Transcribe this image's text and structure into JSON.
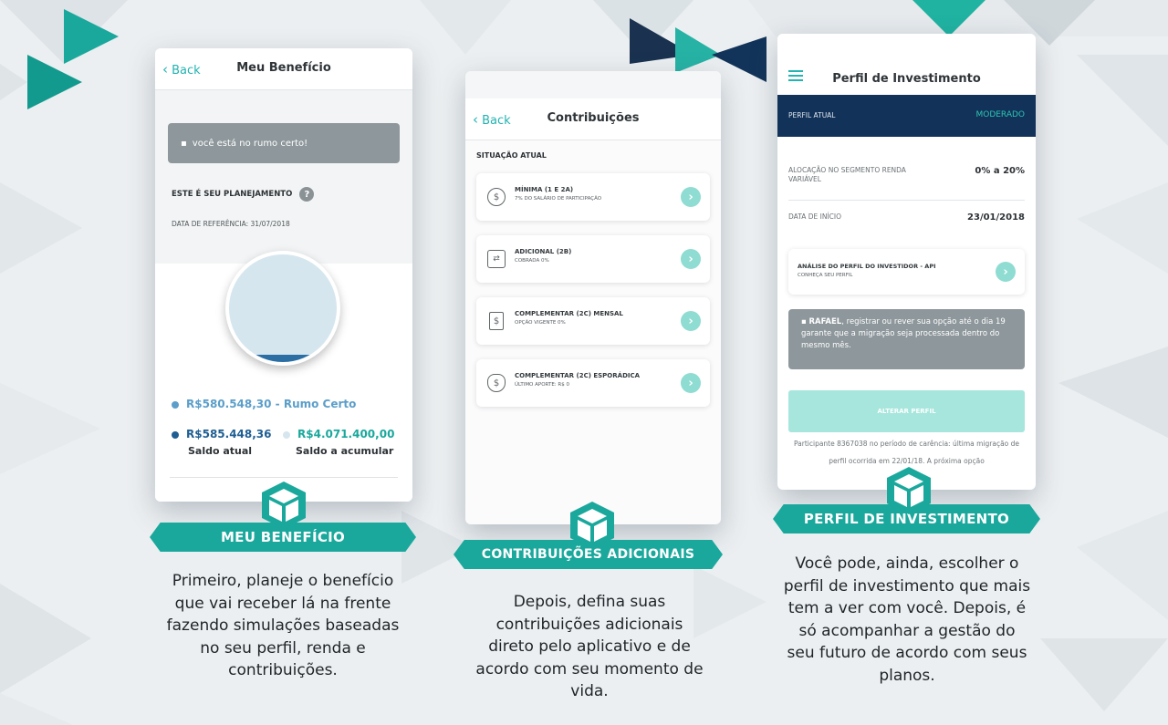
{
  "panels": {
    "beneficio": {
      "back": "Back",
      "title": "Meu Benefício",
      "banner": "você está no rumo certo!",
      "planning_heading": "ESTE É SEU PLANEJAMENTO",
      "help_badge": "?",
      "ref_date": "DATA DE REFERÊNCIA: 31/07/2018",
      "rumo_certo": "R$580.548,30 - Rumo Certo",
      "saldo_atual_value": "R$585.448,36",
      "saldo_atual_label": "Saldo atual",
      "saldo_acumular_value": "R$4.071.400,00",
      "saldo_acumular_label": "Saldo a acumular",
      "fill_fraction": 0.07
    },
    "contribuicoes": {
      "back": "Back",
      "title": "Contribuições",
      "section": "SITUAÇÃO ATUAL",
      "items": [
        {
          "title": "MÍNIMA (1 E 2A)",
          "sub": "7% DO SALÁRIO DE PARTICIPAÇÃO",
          "icon": "coin-icon"
        },
        {
          "title": "ADICIONAL (2B)",
          "sub": "COBRADA 0%",
          "icon": "handshake-icon"
        },
        {
          "title": "COMPLEMENTAR (2C) MENSAL",
          "sub": "OPÇÃO VIGENTE 0%",
          "icon": "document-icon"
        },
        {
          "title": "COMPLEMENTAR (2C) ESPORÁDICA",
          "sub": "ÚLTIMO APORTE: R$ 0",
          "icon": "money-bag-icon"
        }
      ]
    },
    "perfil": {
      "title": "Perfil de Investimento",
      "perfil_atual_label": "PERFIL ATUAL",
      "perfil_atual_value": "MODERADO",
      "alocacao_label": "ALOCAÇÃO NO SEGMENTO RENDA VARIÁVEL",
      "alocacao_value": "0% a 20%",
      "inicio_label": "DATA DE INÍCIO",
      "inicio_value": "23/01/2018",
      "api_title": "ANÁLISE DO PERFIL DO INVESTIDOR - API",
      "api_sub": "CONHEÇA SEU PERFIL",
      "notice_name": "RAFAEL",
      "notice_text": ", registrar ou rever sua opção até o dia 19 garante que a migração seja processada dentro do mesmo mês.",
      "button": "ALTERAR PERFIL",
      "footer": "Participante 8367038 no período de carência: última migração de perfil ocorrida em 22/01/18. A próxima opção"
    }
  },
  "ribbons": [
    "MEU BENEFÍCIO",
    "CONTRIBUIÇÕES ADICIONAIS",
    "PERFIL DE INVESTIMENTO"
  ],
  "captions": [
    "Primeiro, planeje o benefício que vai receber lá na frente fazendo simulações baseadas no seu perfil, renda e contribuições.",
    "Depois, defina suas contribuições adicionais direto pelo aplicativo e de acordo com seu momento de vida.",
    "Você pode, ainda, escolher o perfil de investimento que mais tem a ver com você. Depois, é só acompanhar a gestão do seu futuro de acordo com seus planos."
  ],
  "colors": {
    "teal": "#1aa89c",
    "navy": "#12325a",
    "blue": "#2b6ea4",
    "light_teal": "#8fdcd2"
  }
}
